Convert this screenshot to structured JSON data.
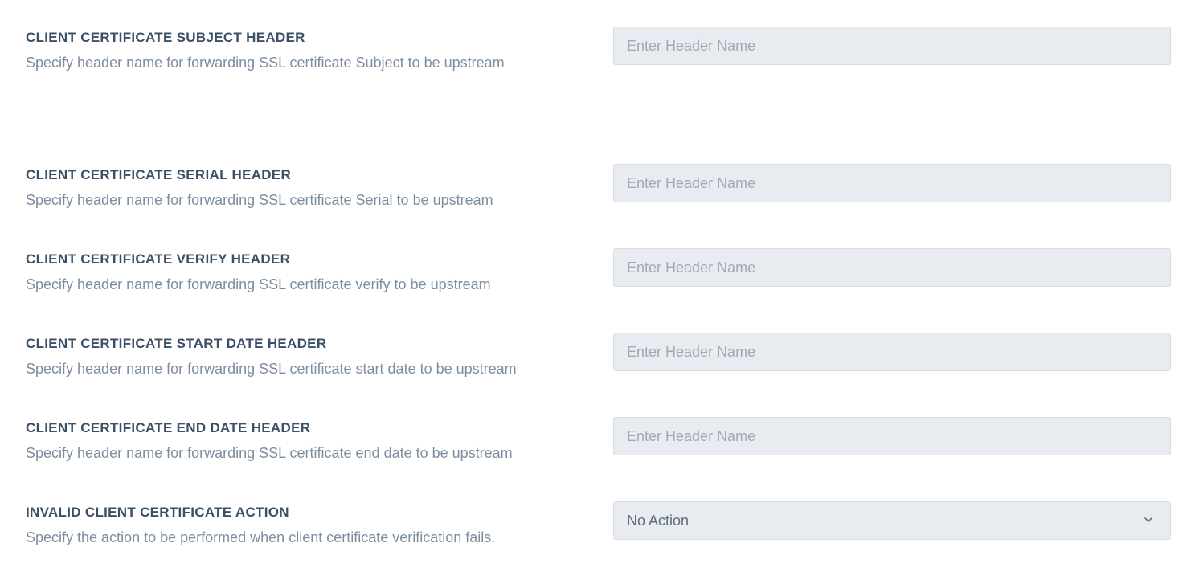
{
  "fields": [
    {
      "title": "CLIENT CERTIFICATE SUBJECT HEADER",
      "description": "Specify header name for forwarding SSL certificate Subject to be upstream",
      "placeholder": "Enter Header Name",
      "value": ""
    },
    {
      "title": "CLIENT CERTIFICATE SERIAL HEADER",
      "description": "Specify header name for forwarding SSL certificate Serial to be upstream",
      "placeholder": "Enter Header Name",
      "value": ""
    },
    {
      "title": "CLIENT CERTIFICATE VERIFY HEADER",
      "description": "Specify header name for forwarding SSL certificate verify to be upstream",
      "placeholder": "Enter Header Name",
      "value": ""
    },
    {
      "title": "CLIENT CERTIFICATE START DATE HEADER",
      "description": "Specify header name for forwarding SSL certificate start date to be upstream",
      "placeholder": "Enter Header Name",
      "value": ""
    },
    {
      "title": "CLIENT CERTIFICATE END DATE HEADER",
      "description": "Specify header name for forwarding SSL certificate end date to be upstream",
      "placeholder": "Enter Header Name",
      "value": ""
    }
  ],
  "action_field": {
    "title": "INVALID CLIENT CERTIFICATE ACTION",
    "description": "Specify the action to be performed when client certificate verification fails.",
    "selected": "No Action",
    "icon": "chevron-down-icon"
  },
  "colors": {
    "title": "#3b4f66",
    "description": "#7d8ea1",
    "input_background": "#e8ecf0",
    "input_border": "#d6dde4",
    "placeholder": "#9daab7"
  }
}
